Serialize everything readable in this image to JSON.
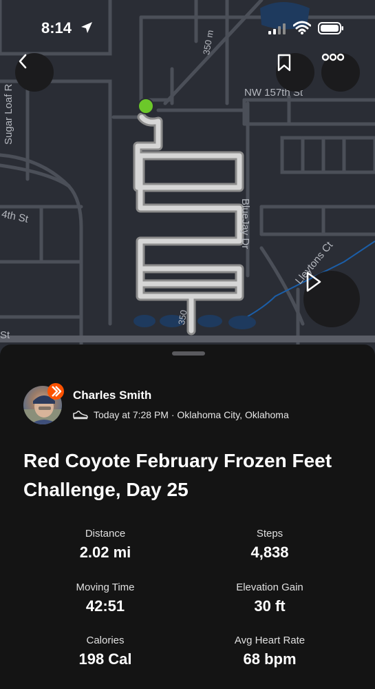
{
  "status_bar": {
    "time": "8:14",
    "icons": [
      "location-arrow-icon",
      "cellular-signal-icon",
      "wifi-icon",
      "battery-icon"
    ]
  },
  "map": {
    "street_labels": {
      "nw_157th": "NW 157th St",
      "sugar_loaf": "Sugar Loaf R",
      "fourth": "4th St",
      "bluejay": "BlueJay Dr",
      "lleytons": "Lleytons Ct",
      "road350_top": "350 m",
      "road350_bottom": "350",
      "st_left": "St"
    },
    "colors": {
      "background": "#2a2d35",
      "road": "#4b4f58",
      "route": "#d6d6d6",
      "start_marker": "#6cc82a",
      "water": "#1e3a5e"
    }
  },
  "controls": {
    "back_icon": "chevron-left-icon",
    "bookmark_icon": "bookmark-icon",
    "more_icon": "more-options-icon",
    "play_icon": "play-icon"
  },
  "activity": {
    "athlete_name": "Charles Smith",
    "activity_icon": "shoe-icon",
    "meta": "Today at 7:28 PM · Oklahoma City, Oklahoma",
    "title": "Red Coyote February Frozen Feet Challenge, Day 25",
    "accent_color": "#fc5200",
    "stats": [
      {
        "label": "Distance",
        "value": "2.02 mi"
      },
      {
        "label": "Steps",
        "value": "4,838"
      },
      {
        "label": "Moving Time",
        "value": "42:51"
      },
      {
        "label": "Elevation Gain",
        "value": "30 ft"
      },
      {
        "label": "Calories",
        "value": "198 Cal"
      },
      {
        "label": "Avg Heart Rate",
        "value": "68 bpm"
      }
    ]
  }
}
